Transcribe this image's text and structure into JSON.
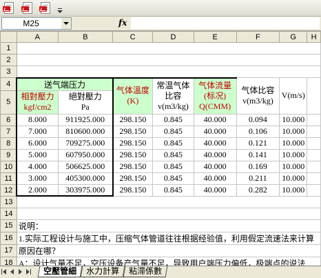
{
  "name_box": "M25",
  "formula_bar_symbol": "fx",
  "formula_content": "",
  "toolbar": {
    "buttons": [
      "pdf-convert-icon",
      "pdf-convert-open-icon",
      "pdf-convert-email-icon"
    ]
  },
  "column_headers": [
    "A",
    "B",
    "C",
    "D",
    "E",
    "F",
    "G",
    "H"
  ],
  "row_numbers": [
    "1",
    "2",
    "3",
    "4",
    "5",
    "6",
    "7",
    "8",
    "9",
    "10",
    "11",
    "12",
    "13",
    "14",
    "15",
    "16",
    "17",
    "18"
  ],
  "header": {
    "group_title": "送气端压力",
    "col_a_line1": "相對壓力",
    "col_a_line2": "kgf/cm2",
    "col_b_line1": "絕對壓力",
    "col_b_line2": "Pa",
    "col_c_line1": "气体溫度",
    "col_c_line2": "(K)",
    "col_d_line1": "常温气体",
    "col_d_line2": "比容",
    "col_d_line3": "v(m3/kg)",
    "col_e_line1": "气体流量",
    "col_e_line2": "(标况)",
    "col_e_line3": "Q(CMM)",
    "col_g_line1": "气体比容",
    "col_g_line2": "v(m3/kg)",
    "col_h": "V(m/s)"
  },
  "rows": [
    {
      "a": "8.000",
      "b": "911925.000",
      "c": "298.150",
      "d": "0.845",
      "e": "40.000",
      "g": "0.094",
      "h": "10.000"
    },
    {
      "a": "7.000",
      "b": "810600.000",
      "c": "298.150",
      "d": "0.845",
      "e": "40.000",
      "g": "0.106",
      "h": "10.000"
    },
    {
      "a": "6.000",
      "b": "709275.000",
      "c": "298.150",
      "d": "0.845",
      "e": "40.000",
      "g": "0.121",
      "h": "10.000"
    },
    {
      "a": "5.000",
      "b": "607950.000",
      "c": "298.150",
      "d": "0.845",
      "e": "40.000",
      "g": "0.141",
      "h": "10.000"
    },
    {
      "a": "4.000",
      "b": "506625.000",
      "c": "298.150",
      "d": "0.845",
      "e": "40.000",
      "g": "0.169",
      "h": "10.000"
    },
    {
      "a": "3.000",
      "b": "405300.000",
      "c": "298.150",
      "d": "0.845",
      "e": "40.000",
      "g": "0.211",
      "h": "10.000"
    },
    {
      "a": "2.000",
      "b": "303975.000",
      "c": "298.150",
      "d": "0.845",
      "e": "40.000",
      "g": "0.282",
      "h": "10.000"
    }
  ],
  "notes": {
    "row15": "说明：",
    "row16": "1.实际工程设计与施工中，压缩气体管道往往根据经验值，利用假定流速法来计算",
    "row17": "原因在哪？",
    "row18": "A：设计气量不足，空压设备产气量不足，导致用户端压力偏低，极端点的说法"
  },
  "sheet_tabs": [
    {
      "label": "空壓管細",
      "active": true
    },
    {
      "label": "水力計算",
      "active": false
    },
    {
      "label": "粘滞係數",
      "active": false
    }
  ],
  "colors": {
    "header_green": "#ccffcc",
    "header_red_text": "#c00000",
    "chrome": "#ece9d8"
  }
}
